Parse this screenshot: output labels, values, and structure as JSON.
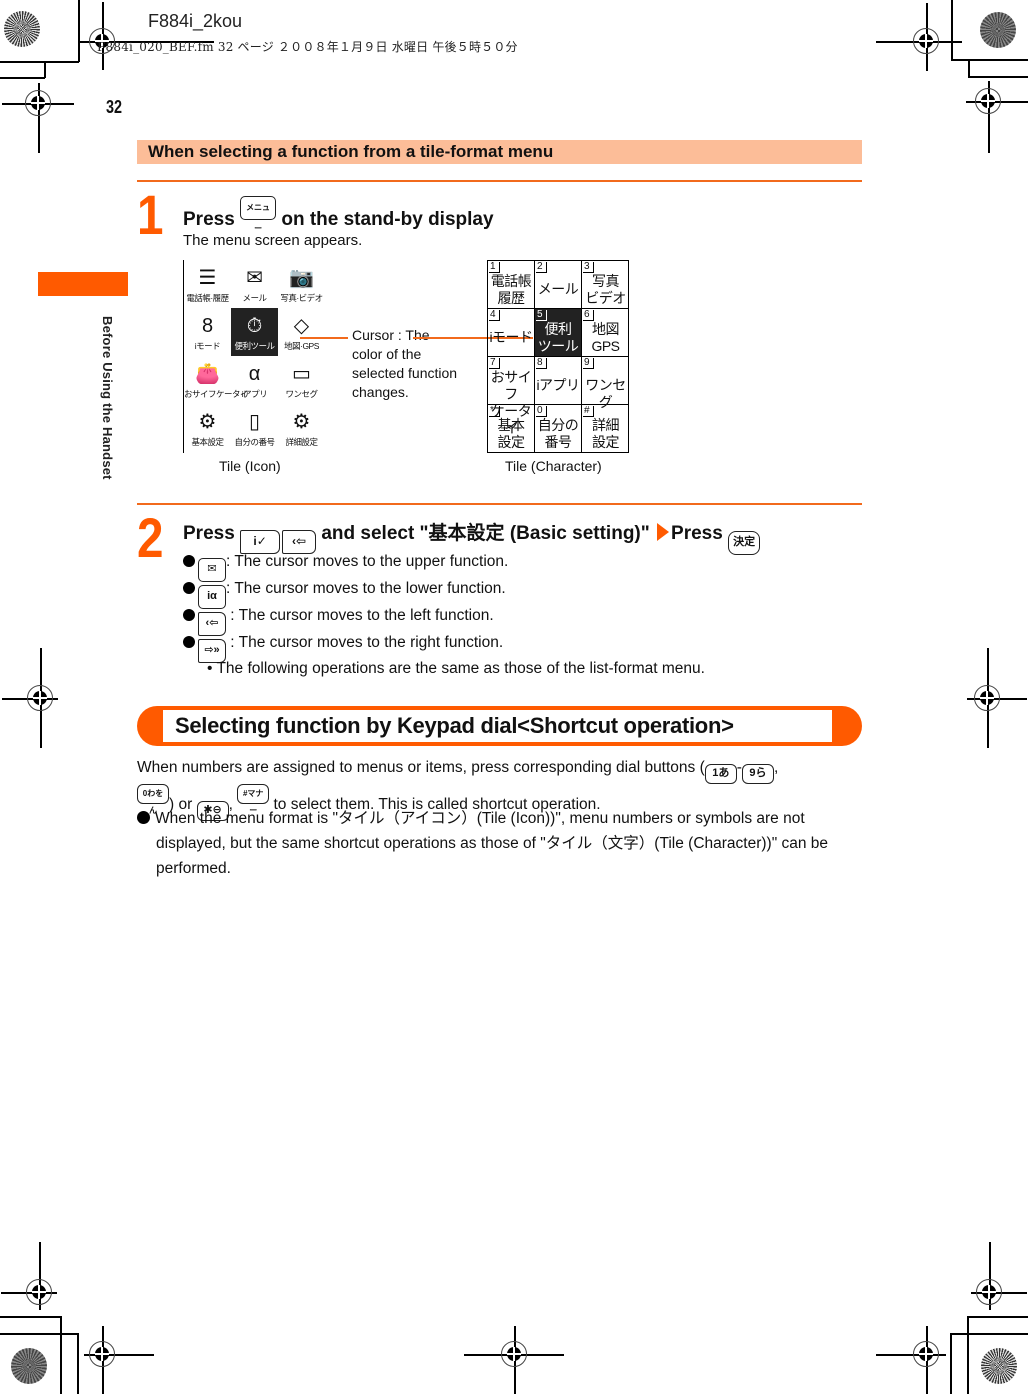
{
  "file_info": {
    "title": "F884i_2kou",
    "meta": "F884i_020_BEF.fm  32 ページ  ２００８年１月９日  水曜日  午後５時５０分"
  },
  "page_number": "32",
  "side_tab": {
    "label": "Before Using the Handset",
    "accent": "#ff5a00"
  },
  "section": {
    "title": "When selecting a function from a tile-format menu",
    "bg_color": "#fcbd98"
  },
  "step1": {
    "number": "1",
    "title_pre": "Press",
    "key_label": "メニュー",
    "title_post": "on the stand-by display",
    "description": "The menu screen appears."
  },
  "tile_icon_menu": {
    "caption": "Tile (Icon)",
    "items": [
      {
        "icon": "phonebook-icon",
        "glyph": "☰",
        "label": "電話帳·履歴",
        "selected": false
      },
      {
        "icon": "mail-icon",
        "glyph": "✉",
        "label": "メール",
        "selected": false
      },
      {
        "icon": "camera-icon",
        "glyph": "📷",
        "label": "写真·ビデオ",
        "selected": false
      },
      {
        "icon": "imode-icon",
        "glyph": "8",
        "label": "iモード",
        "selected": false
      },
      {
        "icon": "tools-icon",
        "glyph": "⏱",
        "label": "便利ツール",
        "selected": true
      },
      {
        "icon": "map-gps-icon",
        "glyph": "◇",
        "label": "地図·GPS",
        "selected": false
      },
      {
        "icon": "wallet-icon",
        "glyph": "👛",
        "label": "おサイフケータイ",
        "selected": false
      },
      {
        "icon": "iappli-icon",
        "glyph": "α",
        "label": "iアプリ",
        "selected": false
      },
      {
        "icon": "tv-icon",
        "glyph": "▭",
        "label": "ワンセグ",
        "selected": false
      },
      {
        "icon": "settings-icon",
        "glyph": "⚙",
        "label": "基本設定",
        "selected": false
      },
      {
        "icon": "phone-icon",
        "glyph": "▯",
        "label": "自分の番号",
        "selected": false
      },
      {
        "icon": "advanced-settings-icon",
        "glyph": "⚙",
        "label": "詳細設定",
        "selected": false
      }
    ]
  },
  "callout": {
    "text": "Cursor : The color of the selected function changes."
  },
  "tile_char_menu": {
    "caption": "Tile (Character)",
    "items": [
      {
        "num": "1",
        "label": "電話帳\n履歴",
        "selected": false
      },
      {
        "num": "2",
        "label": "メール",
        "selected": false
      },
      {
        "num": "3",
        "label": "写真\nビデオ",
        "selected": false
      },
      {
        "num": "4",
        "label": "iモード",
        "selected": false
      },
      {
        "num": "5",
        "label": "便利\nツール",
        "selected": true
      },
      {
        "num": "6",
        "label": "地図\nGPS",
        "selected": false
      },
      {
        "num": "7",
        "label": "おサイフ\nケータイ",
        "selected": false
      },
      {
        "num": "8",
        "label": "iアプリ",
        "selected": false
      },
      {
        "num": "9",
        "label": "ワンセグ",
        "selected": false
      },
      {
        "num": "*",
        "label": "基本\n設定",
        "selected": false
      },
      {
        "num": "0",
        "label": "自分の\n番号",
        "selected": false
      },
      {
        "num": "#",
        "label": "詳細\n設定",
        "selected": false
      }
    ]
  },
  "step2": {
    "number": "2",
    "title_pre": "Press",
    "key1": "i✓",
    "key2": "‹⇦",
    "title_mid": "and select \"基本設定 (Basic setting)\"",
    "title_press": "Press",
    "key3": "決定",
    "bullets": [
      {
        "key": "✉",
        "text": ": The cursor moves to the upper function."
      },
      {
        "key": "iα",
        "text": ": The cursor moves to the lower function."
      },
      {
        "key": "‹⇦",
        "text": " : The cursor moves to the left function."
      },
      {
        "key": "⇨»",
        "text": " : The cursor moves to the right function."
      }
    ],
    "note": "The following operations are the same as those of the list-format menu."
  },
  "shortcut_section": {
    "title": "Selecting function by Keypad dial<Shortcut operation>",
    "para1_a": "When numbers are assigned to menus or items, press corresponding dial buttons (",
    "key_1": "1あ",
    "key_9": "9ら",
    "key_0": "0わをん",
    "para1_b": ") or",
    "key_star": "✱⊖",
    "key_hash": "#マナー",
    "para1_c": "to select them. This is called shortcut operation.",
    "bullet": "When the menu format is \"タイル（アイコン）(Tile (Icon))\", menu numbers or symbols are not displayed, but the same shortcut operations as those of \"タイル（文字）(Tile (Character))\" can be performed."
  }
}
